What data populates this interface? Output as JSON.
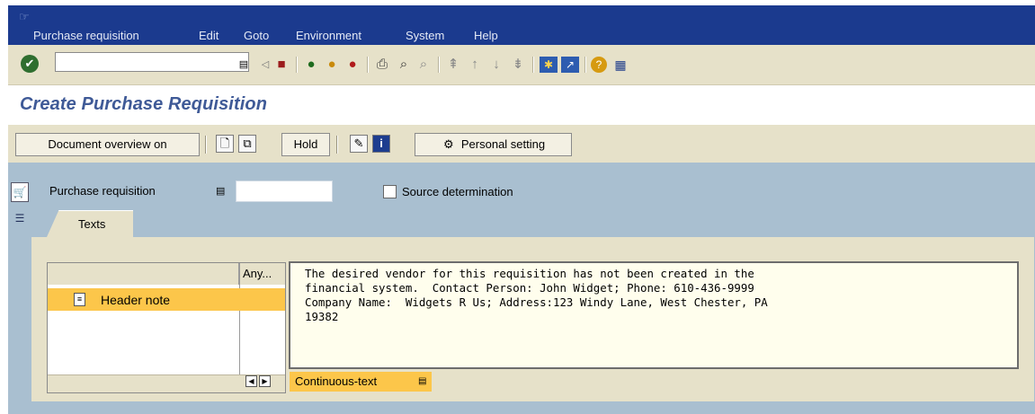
{
  "menubar": {
    "items": [
      "Purchase requisition",
      "Edit",
      "Goto",
      "Environment",
      "System",
      "Help"
    ]
  },
  "toolbar": {
    "command_value": "",
    "icons": [
      "enter-icon",
      "save-icon",
      "back-icon",
      "exit-icon",
      "cancel-icon",
      "print-icon",
      "find-icon",
      "find-next-icon",
      "first-page-icon",
      "previous-page-icon",
      "next-page-icon",
      "last-page-icon",
      "create-session-icon",
      "shortcut-icon",
      "help-icon",
      "layout-menu-icon"
    ]
  },
  "page": {
    "title": "Create Purchase Requisition"
  },
  "app_toolbar": {
    "document_overview": "Document overview on",
    "hold": "Hold",
    "personal_setting": "Personal setting"
  },
  "header": {
    "purchase_requisition_label": "Purchase requisition",
    "purchase_requisition_value": "",
    "source_determination_label": "Source determination",
    "source_determination_checked": false
  },
  "tabs": [
    {
      "label": "Texts",
      "active": true
    }
  ],
  "texts": {
    "tree_column_header": "Any...",
    "tree_items": [
      {
        "label": "Header note",
        "selected": true
      }
    ],
    "editor_lines": [
      "The desired vendor for this requisition has not been created in the",
      "financial system.  Contact Person: John Widget; Phone: 610-436-9999",
      "Company Name:  Widgets R Us; Address:123 Windy Lane, West Chester, PA",
      "19382"
    ],
    "format_label": "Continuous-text"
  },
  "colors": {
    "menubar_bg": "#1b3a8e",
    "toolbar_bg": "#e6e1c9",
    "main_bg": "#a9bfd0",
    "selection": "#fcc64a",
    "title": "#3f5a97"
  }
}
